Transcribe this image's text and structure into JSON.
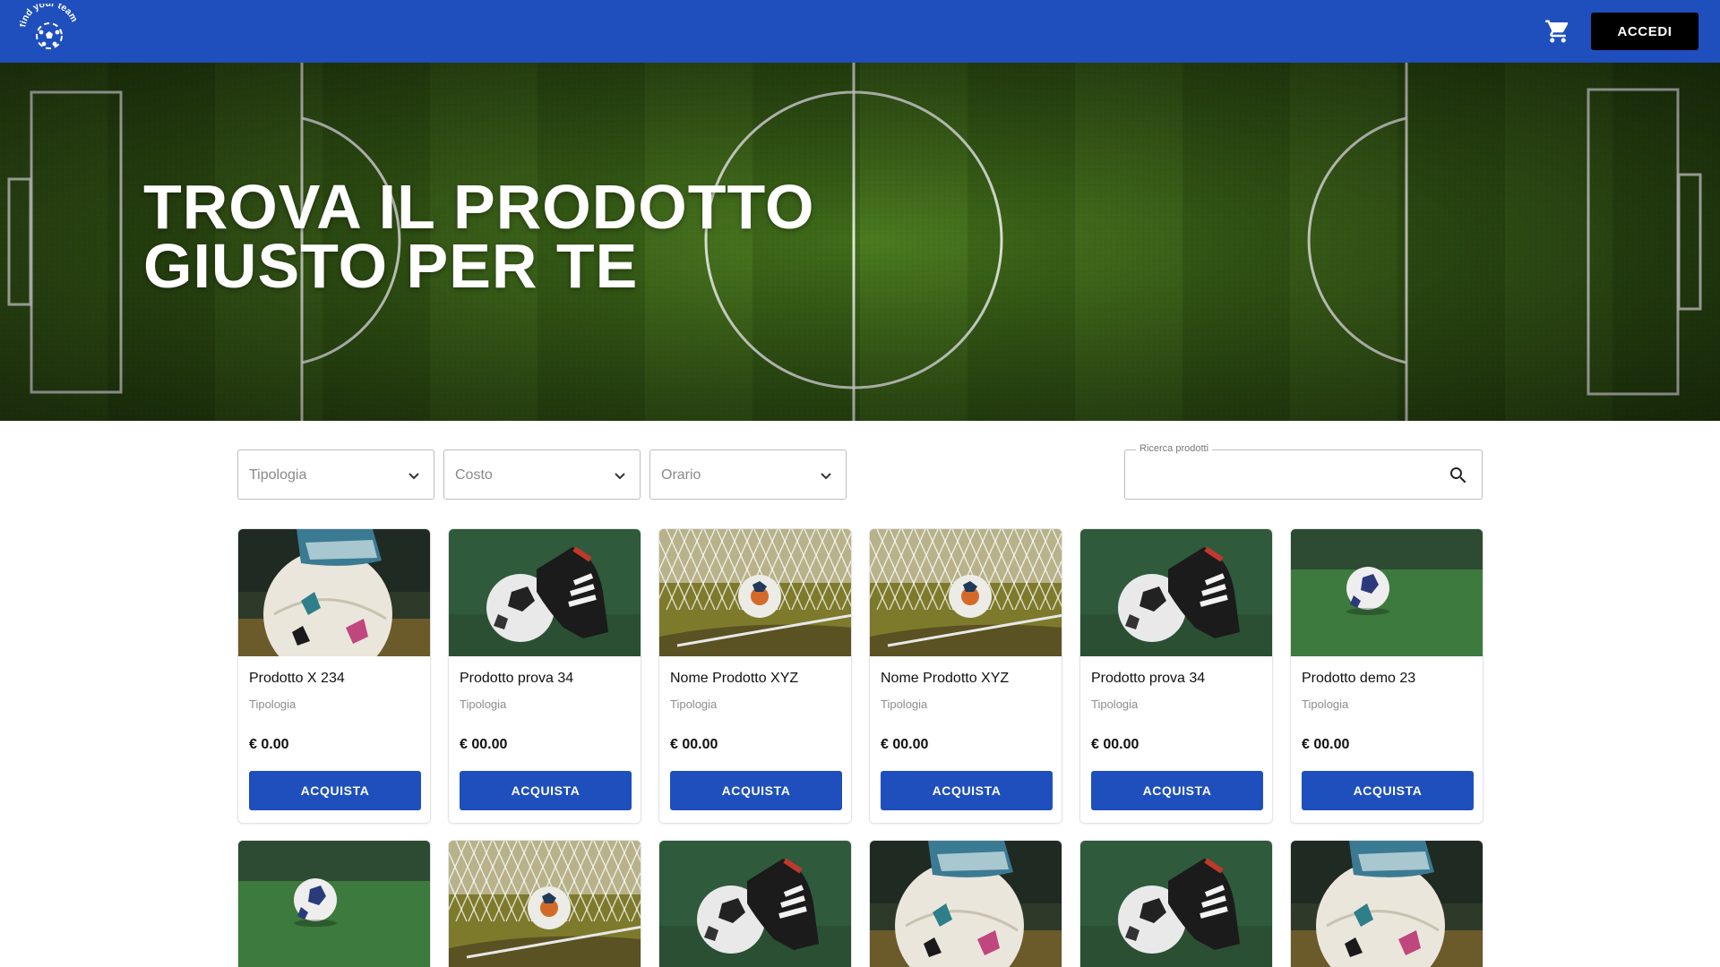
{
  "header": {
    "logo_text": "find your team",
    "cart_icon": "cart-icon",
    "login_label": "ACCEDI",
    "brand_color": "#1e4fbd"
  },
  "hero": {
    "line1": "TROVA IL PRODOTTO",
    "line2": "GIUSTO PER TE"
  },
  "filters": [
    {
      "placeholder": "Tipologia"
    },
    {
      "placeholder": "Costo"
    },
    {
      "placeholder": "Orario"
    }
  ],
  "search": {
    "legend": "Ricerca prodotti",
    "value": ""
  },
  "products": [
    {
      "name": "Prodotto X 234",
      "type": "Tipologia",
      "price": "€ 0.00",
      "buy_label": "ACQUISTA",
      "image": "ball-with-boot-photo"
    },
    {
      "name": "Prodotto prova 34",
      "type": "Tipologia",
      "price": "€ 00.00",
      "buy_label": "ACQUISTA",
      "image": "ball-and-cleat-photo"
    },
    {
      "name": "Nome Prodotto XYZ",
      "type": "Tipologia",
      "price": "€ 00.00",
      "buy_label": "ACQUISTA",
      "image": "ball-in-net-photo"
    },
    {
      "name": "Nome Prodotto XYZ",
      "type": "Tipologia",
      "price": "€ 00.00",
      "buy_label": "ACQUISTA",
      "image": "ball-in-net-photo"
    },
    {
      "name": "Prodotto prova 34",
      "type": "Tipologia",
      "price": "€ 00.00",
      "buy_label": "ACQUISTA",
      "image": "ball-and-cleat-photo"
    },
    {
      "name": "Prodotto demo 23",
      "type": "Tipologia",
      "price": "€ 00.00",
      "buy_label": "ACQUISTA",
      "image": "ball-on-grass-photo"
    }
  ],
  "second_row_images": [
    "ball-on-grass-photo",
    "ball-in-net-photo",
    "ball-and-cleat-photo",
    "ball-with-boot-photo",
    "ball-and-cleat-photo",
    "ball-with-boot-photo"
  ]
}
